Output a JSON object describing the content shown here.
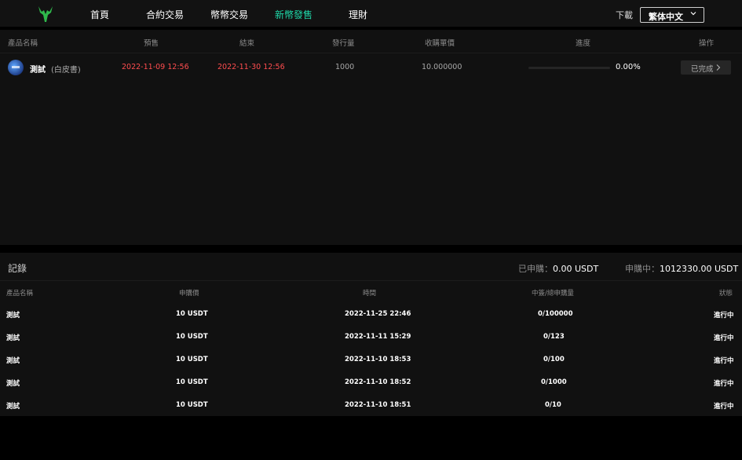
{
  "nav": {
    "items": [
      "首頁",
      "合約交易",
      "幣幣交易",
      "新幣發售",
      "理財"
    ],
    "active": "新幣發售",
    "download": "下載",
    "language": "繁体中文"
  },
  "colors": {
    "accent": "#1fd7a8",
    "red": "#ff4d4f",
    "panel": "#111111"
  },
  "products": {
    "headers": [
      "產品名稱",
      "預售",
      "結束",
      "發行量",
      "收購單價",
      "進度",
      "操作"
    ],
    "rows": [
      {
        "name": "測試",
        "name_sub": "(白皮書)",
        "presale": "2022-11-09 12:56",
        "end": "2022-11-30 12:56",
        "supply": "1000",
        "price": "10.000000",
        "progress": 0,
        "progress_text": "0.00%",
        "action": "已完成"
      }
    ]
  },
  "records": {
    "title": "記錄",
    "subscribed_label": "已申購：",
    "subscribed_value": "0.00 USDT",
    "pending_label": "申購中：",
    "pending_value": "1012330.00 USDT",
    "headers": [
      "產品名稱",
      "申購價",
      "時間",
      "中簽/總申購量",
      "狀態"
    ],
    "rows": [
      {
        "name": "測試",
        "price": "10 USDT",
        "time": "2022-11-25 22:46",
        "qty": "0/100000",
        "status": "進行中"
      },
      {
        "name": "測試",
        "price": "10 USDT",
        "time": "2022-11-11 15:29",
        "qty": "0/123",
        "status": "進行中"
      },
      {
        "name": "測試",
        "price": "10 USDT",
        "time": "2022-11-10 18:53",
        "qty": "0/100",
        "status": "進行中"
      },
      {
        "name": "測試",
        "price": "10 USDT",
        "time": "2022-11-10 18:52",
        "qty": "0/1000",
        "status": "進行中"
      },
      {
        "name": "測試",
        "price": "10 USDT",
        "time": "2022-11-10 18:51",
        "qty": "0/10",
        "status": "進行中"
      }
    ]
  }
}
